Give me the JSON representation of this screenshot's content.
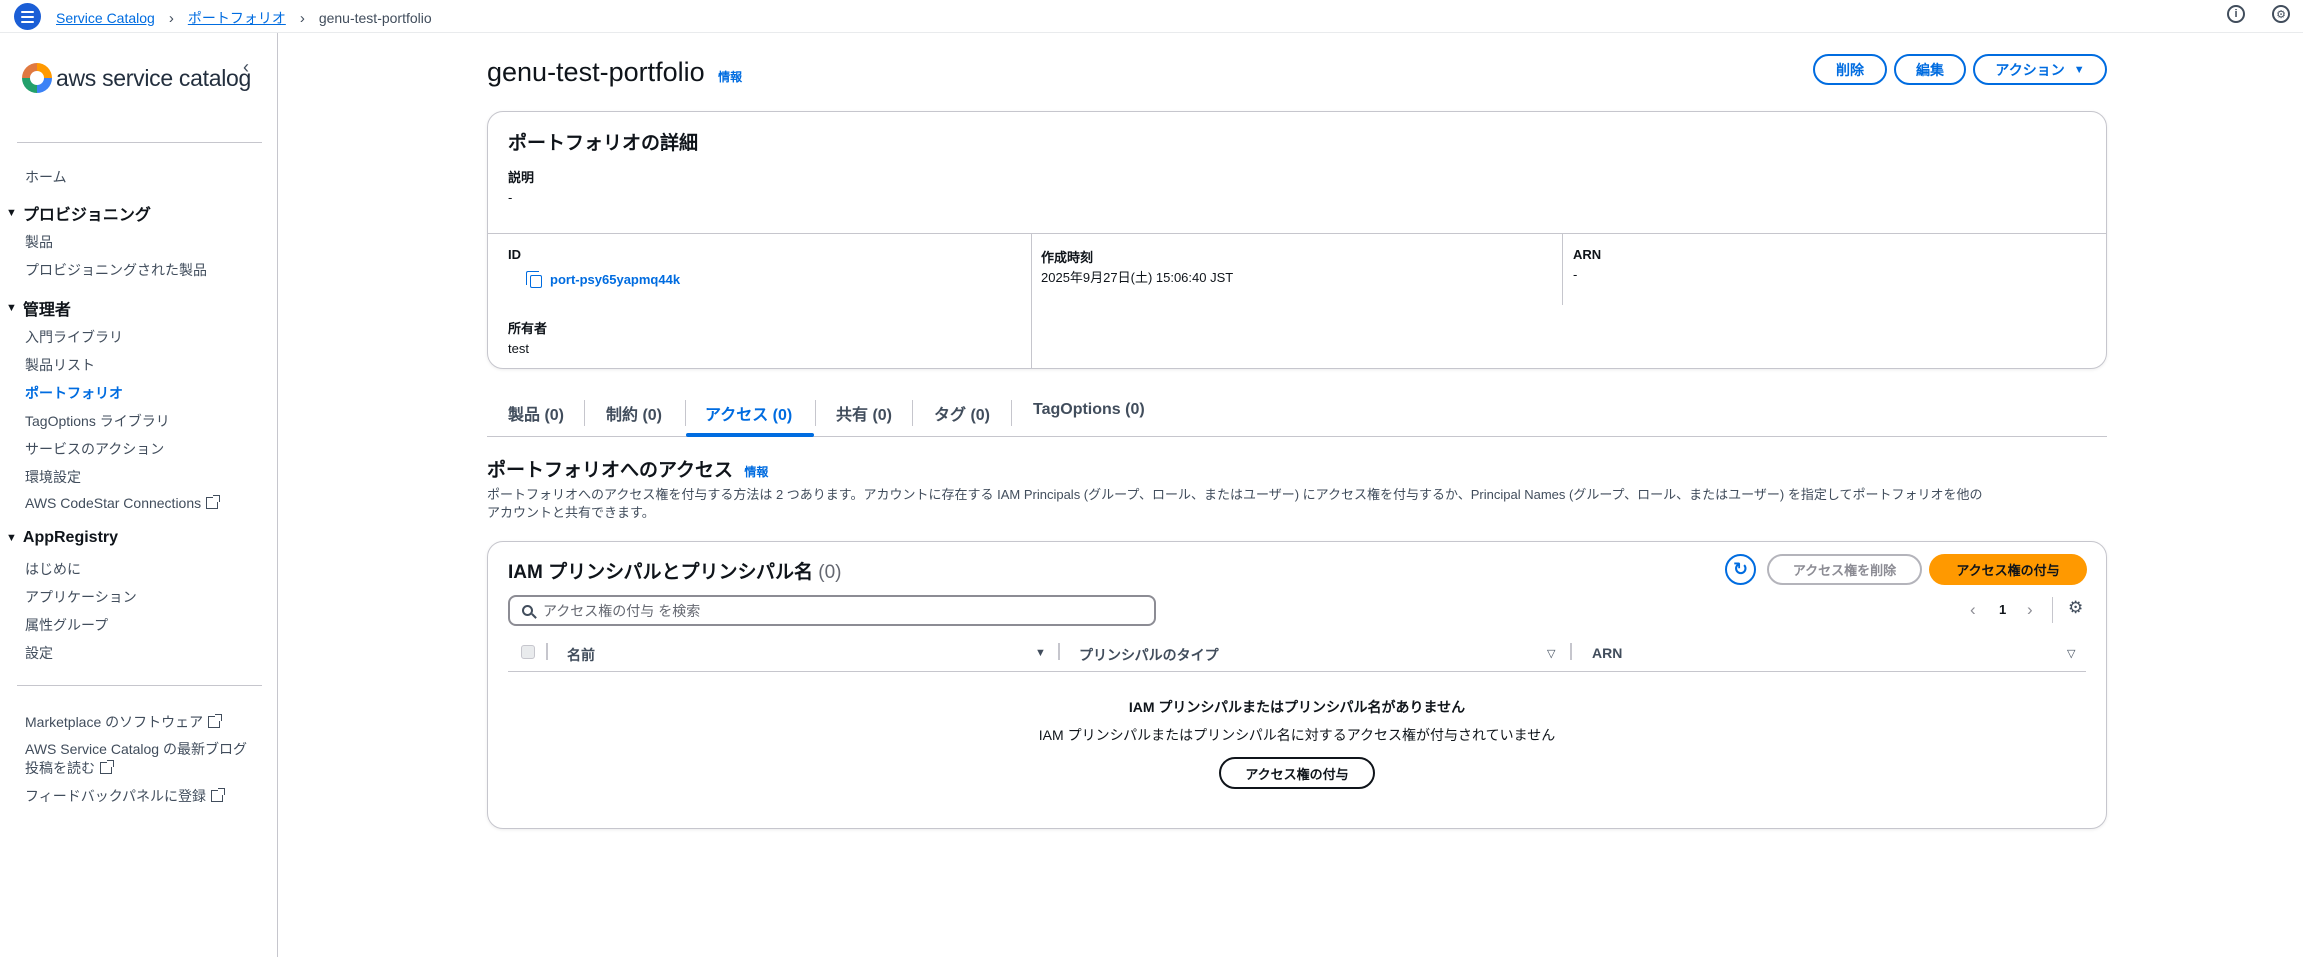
{
  "breadcrumb": {
    "items": [
      "Service Catalog",
      "ポートフォリオ",
      "genu-test-portfolio"
    ]
  },
  "sidebar": {
    "logo_text": "aws service catalog",
    "home": "ホーム",
    "sections": [
      {
        "title": "プロビジョニング",
        "items": [
          "製品",
          "プロビジョニングされた製品"
        ]
      },
      {
        "title": "管理者",
        "items": [
          "入門ライブラリ",
          "製品リスト",
          "ポートフォリオ",
          "TagOptions ライブラリ",
          "サービスのアクション",
          "環境設定",
          "AWS CodeStar Connections"
        ]
      },
      {
        "title": "AppRegistry",
        "items": [
          "はじめに",
          "アプリケーション",
          "属性グループ",
          "設定"
        ]
      }
    ],
    "footer_links": [
      "Marketplace のソフトウェア",
      "AWS Service Catalog の最新ブログ",
      "投稿を読む",
      "フィードバックパネルに登録"
    ]
  },
  "header": {
    "title": "genu-test-portfolio",
    "info": "情報",
    "buttons": {
      "delete": "削除",
      "edit": "編集",
      "actions": "アクション"
    }
  },
  "details": {
    "title": "ポートフォリオの詳細",
    "description_label": "説明",
    "description_value": "-",
    "id_label": "ID",
    "id_value": "port-psy65yapmq44k",
    "owner_label": "所有者",
    "owner_value": "test",
    "created_label": "作成時刻",
    "created_value": "2025年9月27日(土) 15:06:40 JST",
    "arn_label": "ARN",
    "arn_value": "-"
  },
  "tabs": [
    {
      "label": "製品 (0)"
    },
    {
      "label": "制約 (0)"
    },
    {
      "label": "アクセス (0)"
    },
    {
      "label": "共有 (0)"
    },
    {
      "label": "タグ (0)"
    },
    {
      "label": "TagOptions (0)"
    }
  ],
  "access": {
    "title": "ポートフォリオへのアクセス",
    "info": "情報",
    "description_line1": "ポートフォリオへのアクセス権を付与する方法は 2 つあります。アカウントに存在する IAM Principals (グループ、ロール、またはユーザー) にアクセス権を付与するか、Principal Names (グループ、ロール、またはユーザー) を指定してポートフォリオを他の",
    "description_line2": "アカウントと共有できます。"
  },
  "table": {
    "title": "IAM プリンシパルとプリンシパル名",
    "count": "(0)",
    "remove_button": "アクセス権を削除",
    "grant_button": "アクセス権の付与",
    "search_placeholder": "アクセス権の付与 を検索",
    "page": "1",
    "columns": [
      "名前",
      "プリンシパルのタイプ",
      "ARN"
    ],
    "empty_title": "IAM プリンシパルまたはプリンシパル名がありません",
    "empty_desc": "IAM プリンシパルまたはプリンシパル名に対するアクセス権が付与されていません",
    "empty_button": "アクセス権の付与"
  },
  "colors": {
    "accent": "#006ce0",
    "primary_button": "#ff9900",
    "menu_button": "#1b5ed6"
  }
}
